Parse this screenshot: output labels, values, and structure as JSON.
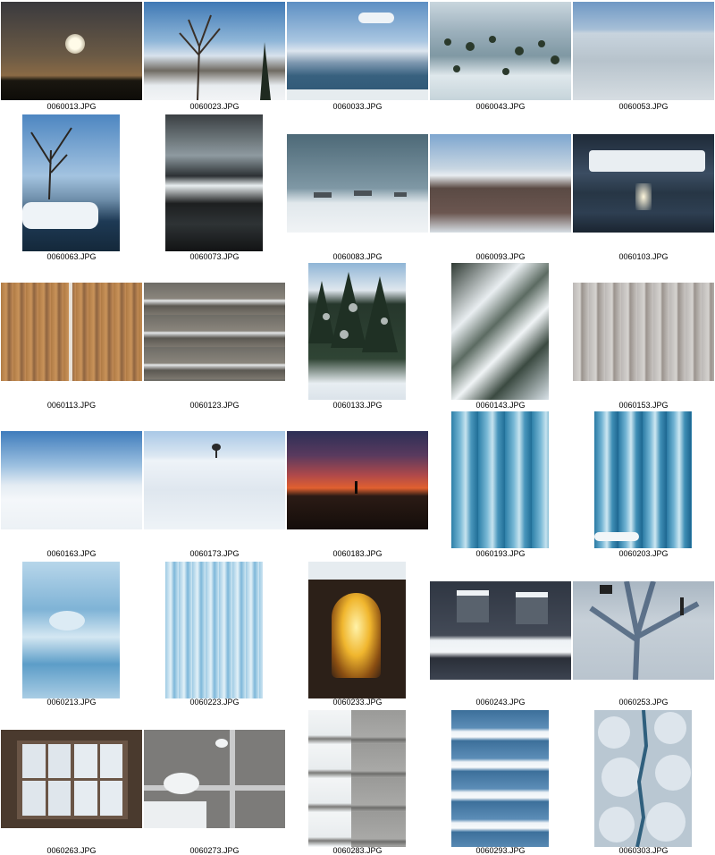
{
  "gallery": {
    "files": [
      "0060013.JPG",
      "0060023.JPG",
      "0060033.JPG",
      "0060043.JPG",
      "0060053.JPG",
      "0060063.JPG",
      "0060073.JPG",
      "0060083.JPG",
      "0060093.JPG",
      "0060103.JPG",
      "0060113.JPG",
      "0060123.JPG",
      "0060133.JPG",
      "0060143.JPG",
      "0060153.JPG",
      "0060163.JPG",
      "0060173.JPG",
      "0060183.JPG",
      "0060193.JPG",
      "0060203.JPG",
      "0060213.JPG",
      "0060223.JPG",
      "0060233.JPG",
      "0060243.JPG",
      "0060253.JPG",
      "0060263.JPG",
      "0060273.JPG",
      "0060283.JPG",
      "0060293.JPG",
      "0060303.JPG"
    ]
  }
}
